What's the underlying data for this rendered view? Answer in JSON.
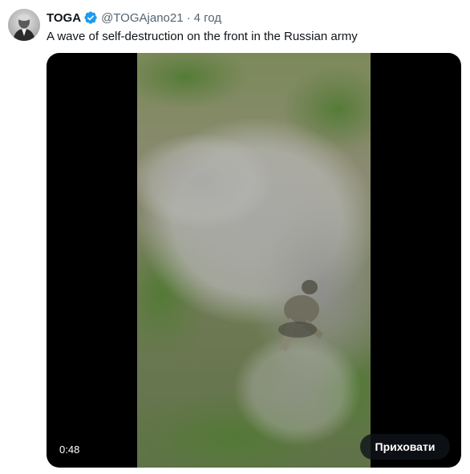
{
  "tweet": {
    "author": {
      "display_name": "TOGA",
      "handle": "@TOGAjano21",
      "separator": "·",
      "time": "4 год",
      "verified": true
    },
    "text": "A wave of self-destruction on the front in the Russian army",
    "media": {
      "type": "video",
      "duration": "0:48",
      "hide_label": "Приховати"
    }
  },
  "colors": {
    "text_primary": "#0f1419",
    "text_secondary": "#536471",
    "verified_blue": "#1d9bf0",
    "media_background": "#000000"
  },
  "icons": {
    "verified": "verified-badge-icon"
  }
}
